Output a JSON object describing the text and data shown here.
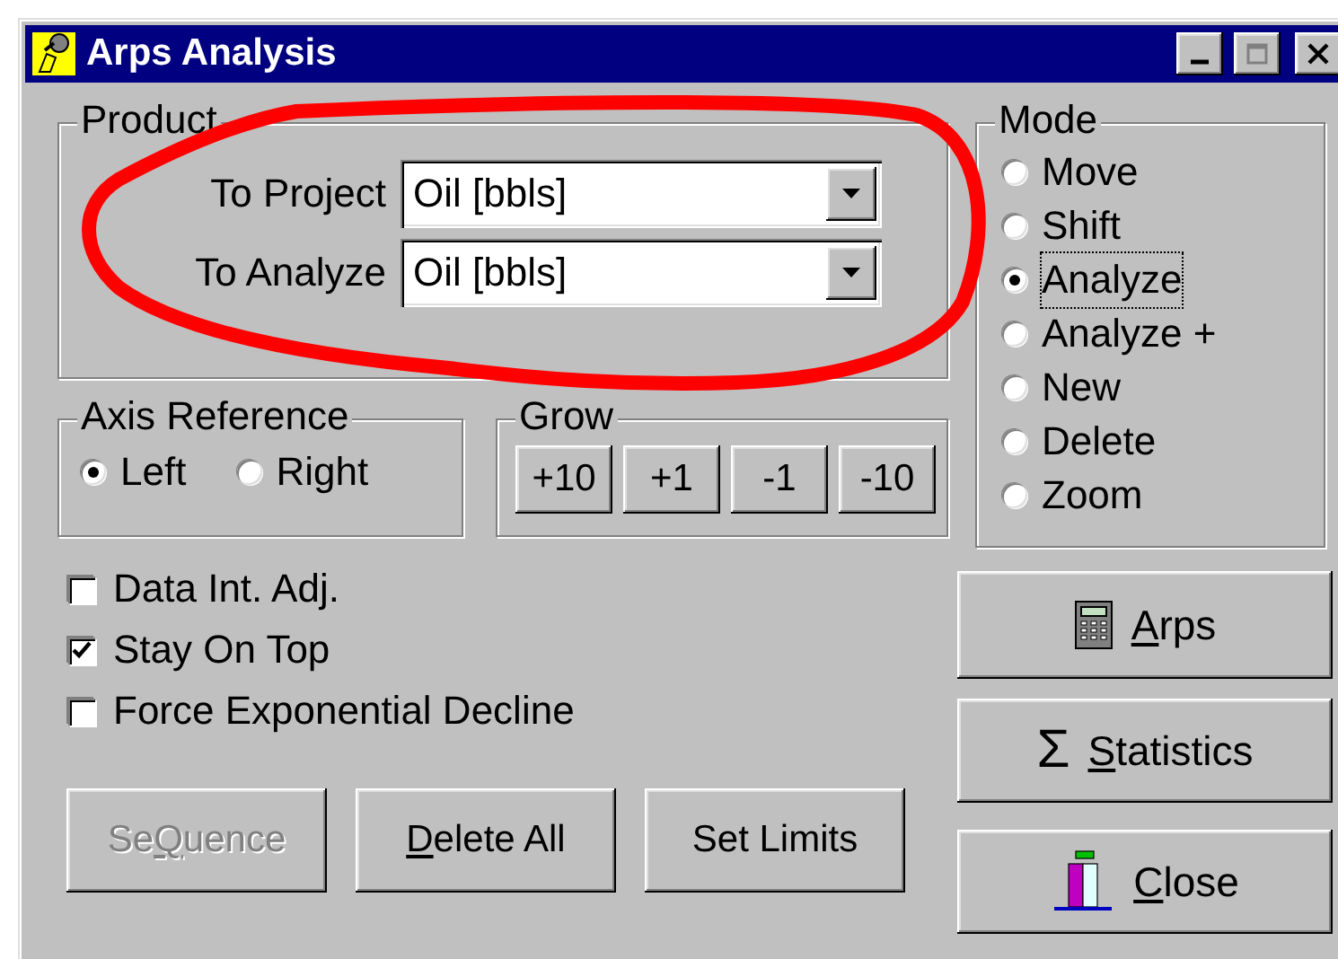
{
  "window": {
    "title": "Arps Analysis"
  },
  "product": {
    "title": "Product",
    "fields": [
      {
        "label": "To Project",
        "value": "Oil [bbls]"
      },
      {
        "label": "To Analyze",
        "value": "Oil [bbls]"
      }
    ]
  },
  "mode": {
    "title": "Mode",
    "options": [
      {
        "label": "Move",
        "selected": false
      },
      {
        "label": "Shift",
        "selected": false
      },
      {
        "label": "Analyze",
        "selected": true
      },
      {
        "label": "Analyze +",
        "selected": false
      },
      {
        "label": "New",
        "selected": false
      },
      {
        "label": "Delete",
        "selected": false
      },
      {
        "label": "Zoom",
        "selected": false
      }
    ]
  },
  "axis_reference": {
    "title": "Axis Reference",
    "options": [
      {
        "label": "Left",
        "selected": true
      },
      {
        "label": "Right",
        "selected": false
      }
    ]
  },
  "grow": {
    "title": "Grow",
    "buttons": [
      "+10",
      "+1",
      "-1",
      "-10"
    ]
  },
  "options": [
    {
      "label": "Data Int. Adj.",
      "checked": false
    },
    {
      "label": "Stay On Top",
      "checked": true
    },
    {
      "label": "Force Exponential Decline",
      "checked": false
    }
  ],
  "bottom_buttons": [
    {
      "label_parts": [
        {
          "text": "Se",
          "underlined": false
        },
        {
          "text": "Q",
          "underlined": true
        },
        {
          "text": "uence",
          "underlined": false
        }
      ],
      "disabled": true
    },
    {
      "label_parts": [
        {
          "text": "D",
          "underlined": true
        },
        {
          "text": "elete All",
          "underlined": false
        }
      ],
      "disabled": false
    },
    {
      "label_parts": [
        {
          "text": "Set Limits",
          "underlined": false
        }
      ],
      "disabled": false
    }
  ],
  "side_buttons": [
    {
      "label_parts": [
        {
          "text": "A",
          "underlined": true
        },
        {
          "text": "rps",
          "underlined": false
        }
      ]
    },
    {
      "label_parts": [
        {
          "text": "S",
          "underlined": true
        },
        {
          "text": "tatistics",
          "underlined": false
        }
      ],
      "symbol": "Σ"
    },
    {
      "label_parts": [
        {
          "text": "C",
          "underlined": true
        },
        {
          "text": "lose",
          "underlined": false
        }
      ]
    }
  ]
}
